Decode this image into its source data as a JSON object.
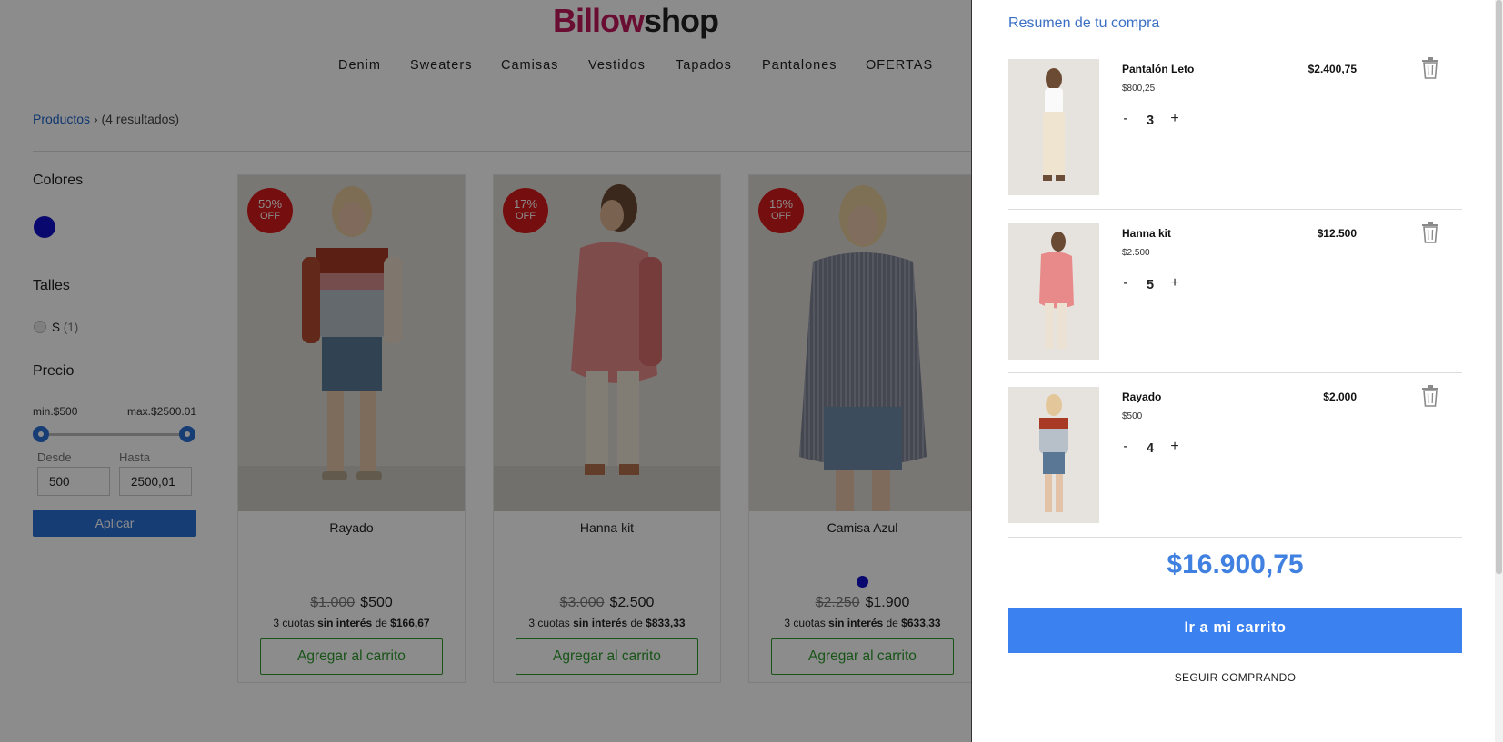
{
  "header": {
    "logo_part1": "Billow",
    "logo_part2": "shop",
    "nav": [
      "Denim",
      "Sweaters",
      "Camisas",
      "Vestidos",
      "Tapados",
      "Pantalones",
      "OFERTAS"
    ]
  },
  "breadcrumb": {
    "link": "Productos",
    "separator": "›",
    "results": "(4 resultados)"
  },
  "filters": {
    "colors_title": "Colores",
    "color_swatch": "#1010c8",
    "sizes_title": "Talles",
    "size_label": "S",
    "size_count": "(1)",
    "price_title": "Precio",
    "min_label": "min.$500",
    "max_label": "max.$2500.01",
    "from_label": "Desde",
    "to_label": "Hasta",
    "from_value": "500",
    "to_value": "2500,01",
    "apply_label": "Aplicar"
  },
  "products": [
    {
      "name": "Rayado",
      "badge_pct": "50%",
      "badge_off": "OFF",
      "old_price": "$1.000",
      "price": "$500",
      "cuotas_pre": "3 cuotas ",
      "cuotas_bold": "sin interés",
      "cuotas_mid": " de ",
      "cuotas_amount": "$166,67",
      "button": "Agregar al carrito"
    },
    {
      "name": "Hanna kit",
      "badge_pct": "17%",
      "badge_off": "OFF",
      "old_price": "$3.000",
      "price": "$2.500",
      "cuotas_pre": "3 cuotas ",
      "cuotas_bold": "sin interés",
      "cuotas_mid": " de ",
      "cuotas_amount": "$833,33",
      "button": "Agregar al carrito"
    },
    {
      "name": "Camisa Azul",
      "badge_pct": "16%",
      "badge_off": "OFF",
      "old_price": "$2.250",
      "price": "$1.900",
      "cuotas_pre": "3 cuotas ",
      "cuotas_bold": "sin interés",
      "cuotas_mid": " de ",
      "cuotas_amount": "$633,33",
      "button": "Agregar al carrito"
    }
  ],
  "cart": {
    "title": "Resumen de tu compra",
    "items": [
      {
        "name": "Pantalón Leto",
        "unit_price": "$800,25",
        "total": "$2.400,75",
        "qty": "3",
        "minus": "-",
        "plus": "+"
      },
      {
        "name": "Hanna kit",
        "unit_price": "$2.500",
        "total": "$12.500",
        "qty": "5",
        "minus": "-",
        "plus": "+"
      },
      {
        "name": "Rayado",
        "unit_price": "$500",
        "total": "$2.000",
        "qty": "4",
        "minus": "-",
        "plus": "+"
      }
    ],
    "total": "$16.900,75",
    "checkout_label": "Ir a mi carrito",
    "continue_label": "SEGUIR COMPRANDO"
  }
}
